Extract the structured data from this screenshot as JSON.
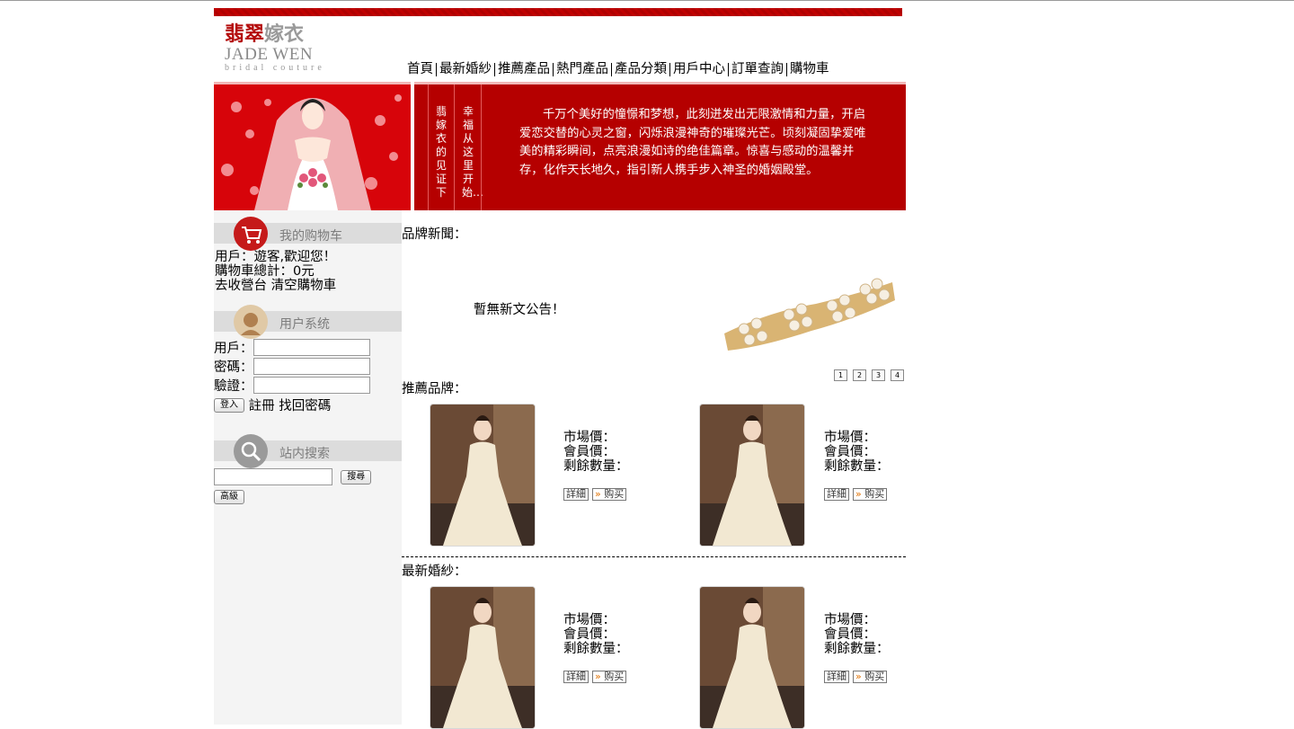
{
  "logo": {
    "cn_a": "翡翠",
    "cn_b": "嫁衣",
    "en": "JADE WEN",
    "sub": "bridal couture"
  },
  "nav": [
    "首頁",
    "最新婚紗",
    "推薦產品",
    "熱門產品",
    "產品分類",
    "用戶中心",
    "訂單查詢",
    "購物車"
  ],
  "banner": {
    "vertical_1": "翡嫁衣的见证下",
    "vertical_2": "幸福从这里开始…",
    "paragraph": "千万个美好的憧憬和梦想，此刻迸发出无限激情和力量，开启爱恋交替的心灵之窗，闪烁浪漫神奇的璀璨光芒。顷刻凝固挚爱唯美的精彩瞬间，点亮浪漫如诗的绝佳篇章。惊喜与感动的温馨并存，化作天长地久，指引新人携手步入神圣的婚姻殿堂。"
  },
  "cart": {
    "title": "我的购物车",
    "line1": "用戶：遊客,歡迎您！",
    "line2": "購物車總計：0元",
    "checkout": "去收營台",
    "clear": "清空購物車"
  },
  "usersys": {
    "title": "用户系统",
    "user_label": "用戶：",
    "pass_label": "密碼：",
    "verify_label": "驗證：",
    "login": "登入",
    "register": "註冊",
    "forgot": "找回密碼"
  },
  "search": {
    "title": "站内搜索",
    "button": "搜尋",
    "advanced": "高級"
  },
  "brand_news": {
    "title": "品牌新聞：",
    "empty": "暫無新文公告！",
    "pages": [
      "1",
      "2",
      "3",
      "4"
    ]
  },
  "recommend": {
    "title": "推薦品牌："
  },
  "latest": {
    "title": "最新婚紗："
  },
  "product_labels": {
    "market": "市場價：",
    "member": "會員價：",
    "stock": "剩餘數量：",
    "detail": "詳細",
    "buy": "购买"
  },
  "colors": {
    "brand_red": "#b50000",
    "sidebar_bg": "#f4f4f4"
  }
}
